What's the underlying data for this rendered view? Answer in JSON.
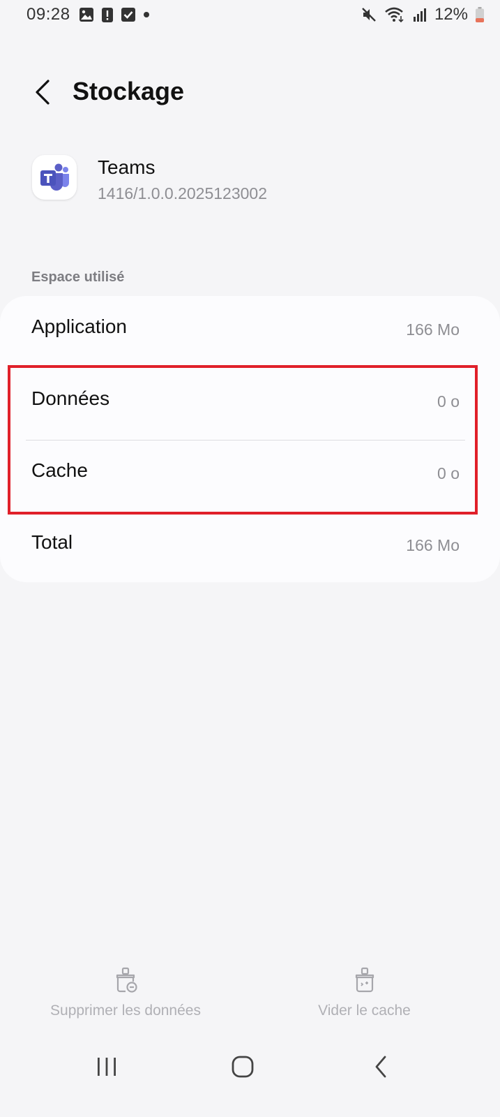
{
  "status_bar": {
    "time": "09:28",
    "battery_percent": "12%",
    "left_icons": [
      "image-icon",
      "alert-icon",
      "check-icon",
      "dot-icon"
    ],
    "right_icons": [
      "mute-icon",
      "wifi-icon",
      "signal-icon",
      "battery-icon"
    ]
  },
  "header": {
    "title": "Stockage"
  },
  "app": {
    "name": "Teams",
    "version": "1416/1.0.0.2025123002",
    "icon": "teams-icon"
  },
  "storage": {
    "section_label": "Espace utilisé",
    "rows": [
      {
        "label": "Application",
        "value": "166 Mo"
      },
      {
        "label": "Données",
        "value": "0 o"
      },
      {
        "label": "Cache",
        "value": "0 o"
      },
      {
        "label": "Total",
        "value": "166 Mo"
      }
    ]
  },
  "actions": {
    "delete_data": "Supprimer les données",
    "clear_cache": "Vider le cache"
  },
  "colors": {
    "highlight": "#e0202a",
    "teams_purple": "#5b5fc7"
  }
}
